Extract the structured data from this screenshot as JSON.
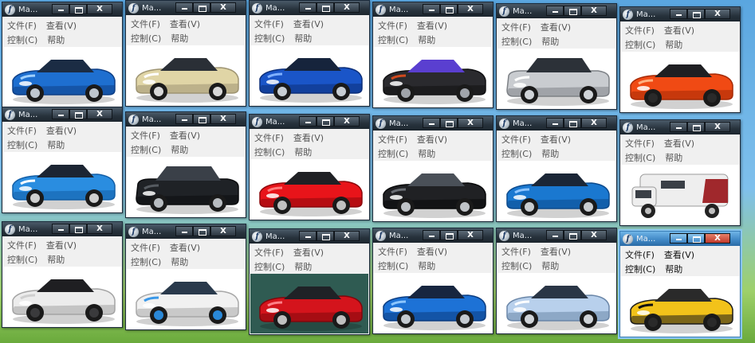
{
  "title": "Ma...",
  "menu_labels": {
    "file": "文件(F)",
    "view": "查看(V)",
    "control": "控制(C)",
    "help": "帮助"
  },
  "close_glyph": "X",
  "app_icon_glyph": "f",
  "windows": [
    {
      "car": "Jaguar sports coupe",
      "body": "#1e6fd0",
      "shade": "#0e3f86",
      "glass": "#1b2c44",
      "rim": "#bfc7cf",
      "accent": "#9fd0ff"
    },
    {
      "car": "Toyota sedan",
      "body": "#e0d5a6",
      "shade": "#9e9472",
      "glass": "#2a2f36",
      "rim": "#d8d8d8",
      "accent": "#ffffff"
    },
    {
      "car": "BMW roadster",
      "body": "#1a55c8",
      "shade": "#0c2f7a",
      "glass": "#16243c",
      "rim": "#c8ced4",
      "accent": "#7fb0ff"
    },
    {
      "car": "Koenigsegg supercar",
      "body": "#2a2a2e",
      "shade": "#101012",
      "glass": "#5a3fd0",
      "rim": "#a0a4aa",
      "accent": "#d04a1e"
    },
    {
      "car": "Volvo SUV",
      "body": "#c9ccd0",
      "shade": "#7d8186",
      "glass": "#2c3138",
      "rim": "#d0d4d8",
      "accent": "#ffffff"
    },
    {
      "car": "Lamborghini Aventador",
      "body": "#f04a14",
      "shade": "#a52a06",
      "glass": "#1f1f22",
      "rim": "#2a2a2a",
      "accent": "#ffb080"
    },
    {
      "car": "Mini Cooper",
      "body": "#2a8de0",
      "shade": "#135ea6",
      "glass": "#1c2533",
      "rim": "#d0d0d0",
      "accent": "#ffffff"
    },
    {
      "car": "Range Rover",
      "body": "#1f2226",
      "shade": "#0b0c0e",
      "glass": "#3a4048",
      "rim": "#b8bcc0",
      "accent": "#555a60"
    },
    {
      "car": "Ferrari 458",
      "body": "#e8141a",
      "shade": "#8d080c",
      "glass": "#1f2024",
      "rim": "#c0c0c0",
      "accent": "#ff7c7c"
    },
    {
      "car": "Mercedes-Benz sedan",
      "body": "#202124",
      "shade": "#08090a",
      "glass": "#4a5058",
      "rim": "#c0c4c8",
      "accent": "#6a6e74"
    },
    {
      "car": "Honda Fit",
      "body": "#1a78d0",
      "shade": "#0c4a8c",
      "glass": "#1b2636",
      "rim": "#c8ccd0",
      "accent": "#8cc4ff"
    },
    {
      "car": "Ford motorhome",
      "body": "#eeeeee",
      "shade": "#9a9a9a",
      "glass": "#3a3f46",
      "rim": "#c0c0c0",
      "accent": "#a0282c"
    },
    {
      "car": "White concept supercar",
      "body": "#ececec",
      "shade": "#a4a4a4",
      "glass": "#1f1f22",
      "rim": "#3a3a3c",
      "accent": "#cfcfcf"
    },
    {
      "car": "Spyker supercar",
      "body": "#f1f1f1",
      "shade": "#a8a8a8",
      "glass": "#2a3a4c",
      "rim": "#2a88d8",
      "accent": "#3a98e8"
    },
    {
      "car": "Mazda 6",
      "body": "#d4141c",
      "shade": "#80070c",
      "glass": "#1f2226",
      "rim": "#c0c0c0",
      "accent": "#ff8088"
    },
    {
      "car": "Jaguar XK",
      "body": "#1d72d6",
      "shade": "#0b3c80",
      "glass": "#172640",
      "rim": "#c4cad0",
      "accent": "#8cc6ff"
    },
    {
      "car": "Lexus sedan",
      "body": "#b8d0ec",
      "shade": "#6a86a8",
      "glass": "#2a3646",
      "rim": "#d0d4d8",
      "accent": "#ffffff"
    },
    {
      "car": "Lotus 2-Eleven",
      "body": "#f2c21a",
      "shade": "#1a1a1a",
      "glass": "#2a2a2a",
      "rim": "#2a2a2a",
      "accent": "#111111"
    }
  ]
}
